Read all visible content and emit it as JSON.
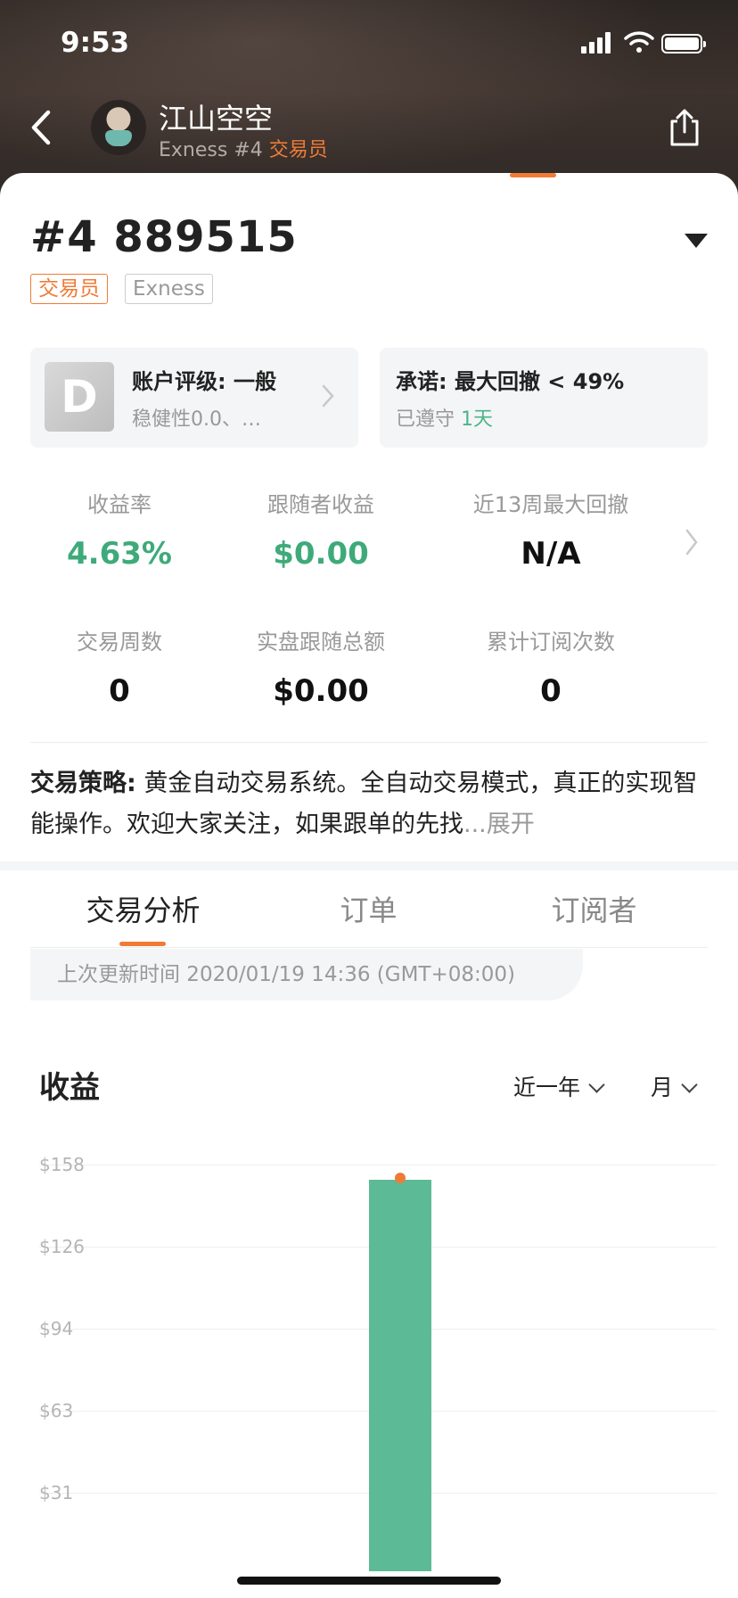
{
  "status_bar": {
    "time": "9:53"
  },
  "nav": {
    "name": "江山空空",
    "broker": "Exness",
    "rank": "#4",
    "role": "交易员"
  },
  "account": {
    "title": "#4 889515",
    "role_tag": "交易员",
    "broker_tag": "Exness"
  },
  "rating": {
    "badge": "D",
    "title": "账户评级: 一般",
    "subtitle": "稳健性0.0、…"
  },
  "promise": {
    "title": "承诺: 最大回撤 < 49%",
    "status_prefix": "已遵守",
    "days": "1天"
  },
  "stats": [
    {
      "label": "收益率",
      "value": "4.63%",
      "highlight": true
    },
    {
      "label": "跟随者收益",
      "value": "$0.00",
      "highlight": true
    },
    {
      "label": "近13周最大回撤",
      "value": "N/A",
      "highlight": false
    },
    {
      "label": "交易周数",
      "value": "0",
      "highlight": false
    },
    {
      "label": "实盘跟随总额",
      "value": "$0.00",
      "highlight": false
    },
    {
      "label": "累计订阅次数",
      "value": "0",
      "highlight": false
    }
  ],
  "strategy": {
    "label": "交易策略:",
    "text": " 黄金自动交易系统。全自动交易模式，真正的实现智能操作。欢迎大家关注，如果跟单的先找",
    "more": "...展开"
  },
  "tabs": [
    {
      "label": "交易分析",
      "active": true
    },
    {
      "label": "订单",
      "active": false
    },
    {
      "label": "订阅者",
      "active": false
    }
  ],
  "update": {
    "text": "上次更新时间 2020/01/19 14:36 (GMT+08:00)"
  },
  "chart_section": {
    "title": "收益",
    "period": "近一年",
    "unit": "月"
  },
  "chart_data": {
    "type": "bar",
    "title": "收益",
    "xlabel": "",
    "ylabel": "",
    "yticks": [
      "$158",
      "$126",
      "$94",
      "$63",
      "$31"
    ],
    "ylim": [
      0,
      158
    ],
    "categories": [
      ""
    ],
    "values": [
      152
    ],
    "grid": true
  },
  "colors": {
    "accent": "#f07b36",
    "positive": "#3eaa7a",
    "bar": "#5cba96"
  }
}
